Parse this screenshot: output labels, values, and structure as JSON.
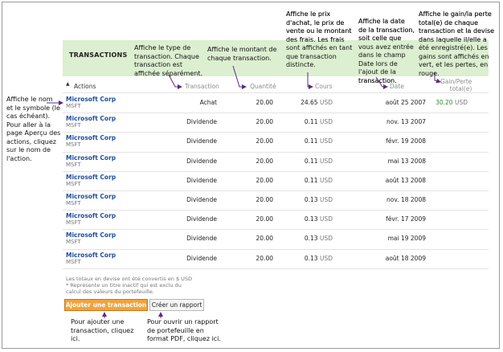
{
  "annotations": {
    "name_symbol": "Affiche le nom et le symbole (le cas échéant). Pour aller à la page Aperçu des actions, cliquez sur le nom de l'action.",
    "transaction_type": "Affiche le type de transaction. Chaque transaction est affichée séparément.",
    "quantity": "Affiche le montant de chaque transaction.",
    "price": "Affiche le prix d'achat, le prix de vente ou le montant des frais. Les frais sont affichés en tant que transaction distincte.",
    "date": "Affiche la date de la transaction, soit celle que vous avez entrée dans le champ Date lors de l'ajout de la transaction.",
    "gain": "Affiche le gain/la perte total(e) de chaque transaction et la devise dans laquelle il/elle a été enregistré(e). Les gains sont affichés en vert, et les pertes, en rouge.",
    "add_transaction": "Pour ajouter une transaction, cliquez ici.",
    "create_report": "Pour ouvrir un rapport de portefeuille en format PDF, cliquez ici."
  },
  "table": {
    "title": "TRANSACTIONS",
    "headers": {
      "actions": "Actions",
      "transaction": "Transaction",
      "quantity": "Quantité",
      "price": "Cours",
      "date": "Date",
      "gain_line1": "Gain/Perte",
      "gain_line2": "total(e)"
    },
    "rows": [
      {
        "name": "Microsoft Corp",
        "symbol": "MSFT",
        "type": "Achat",
        "qty": "20.00",
        "price": "24.65",
        "currency": "USD",
        "date": "août 25 2007",
        "gain": "30.20",
        "gain_currency": "USD"
      },
      {
        "name": "Microsoft Corp",
        "symbol": "MSFT",
        "type": "Dividende",
        "qty": "20.00",
        "price": "0.11",
        "currency": "USD",
        "date": "nov. 13 2007",
        "gain": "",
        "gain_currency": ""
      },
      {
        "name": "Microsoft Corp",
        "symbol": "MSFT",
        "type": "Dividende",
        "qty": "20.00",
        "price": "0.11",
        "currency": "USD",
        "date": "févr. 19 2008",
        "gain": "",
        "gain_currency": ""
      },
      {
        "name": "Microsoft Corp",
        "symbol": "MSFT",
        "type": "Dividende",
        "qty": "20.00",
        "price": "0.11",
        "currency": "USD",
        "date": "mai 13 2008",
        "gain": "",
        "gain_currency": ""
      },
      {
        "name": "Microsoft Corp",
        "symbol": "MSFT",
        "type": "Dividende",
        "qty": "20.00",
        "price": "0.11",
        "currency": "USD",
        "date": "août 13 2008",
        "gain": "",
        "gain_currency": ""
      },
      {
        "name": "Microsoft Corp",
        "symbol": "MSFT",
        "type": "Dividende",
        "qty": "20.00",
        "price": "0.13",
        "currency": "USD",
        "date": "nov. 18 2008",
        "gain": "",
        "gain_currency": ""
      },
      {
        "name": "Microsoft Corp",
        "symbol": "MSFT",
        "type": "Dividende",
        "qty": "20.00",
        "price": "0.13",
        "currency": "USD",
        "date": "févr. 17 2009",
        "gain": "",
        "gain_currency": ""
      },
      {
        "name": "Microsoft Corp",
        "symbol": "MSFT",
        "type": "Dividende",
        "qty": "20.00",
        "price": "0.13",
        "currency": "USD",
        "date": "mai 19 2009",
        "gain": "",
        "gain_currency": ""
      },
      {
        "name": "Microsoft Corp",
        "symbol": "MSFT",
        "type": "Dividende",
        "qty": "20.00",
        "price": "0.13",
        "currency": "USD",
        "date": "août 18 2009",
        "gain": "",
        "gain_currency": ""
      }
    ]
  },
  "footnotes": {
    "line1": "Les totaux en devise ont été convertis en $ USD",
    "line2": "* Représente un titre inactif qui est exclu du",
    "line3": "calcul des valeurs du portefeuille."
  },
  "buttons": {
    "add_transaction": "Ajouter une transaction",
    "create_report": "Créer un rapport"
  },
  "colors": {
    "header_band": "#dcefd0",
    "link": "#1f4e9e",
    "gain_positive": "#2e8b2e",
    "loss_negative": "#cc0000",
    "primary_button": "#f2a33a",
    "arrow": "#5a2a82"
  }
}
